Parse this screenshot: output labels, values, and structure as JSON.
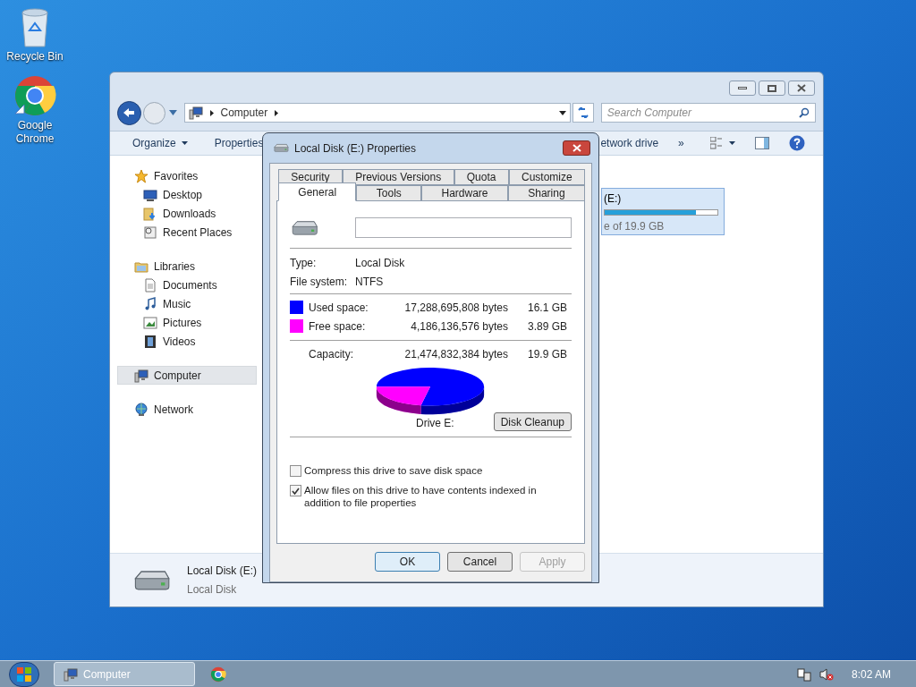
{
  "desktop_icons": [
    {
      "label": "Recycle Bin",
      "kind": "recycle-bin"
    },
    {
      "label": "Google Chrome",
      "kind": "chrome"
    }
  ],
  "explorer": {
    "address": {
      "crumbs": [
        "Computer"
      ]
    },
    "search": {
      "placeholder": "Search Computer"
    },
    "toolbar": {
      "left": [
        {
          "label": "Organize",
          "menu": true
        },
        {
          "label": "Properties",
          "menu": false
        }
      ],
      "right": [
        "etwork drive",
        "»"
      ]
    },
    "nav": [
      {
        "label": "Favorites",
        "kind": "star",
        "selected": false,
        "children": [
          {
            "label": "Desktop",
            "kind": "desktop",
            "selected": false
          },
          {
            "label": "Downloads",
            "kind": "downloads",
            "selected": false
          },
          {
            "label": "Recent Places",
            "kind": "recent",
            "selected": false
          }
        ]
      },
      {
        "label": "Libraries",
        "kind": "library",
        "selected": false,
        "children": [
          {
            "label": "Documents",
            "kind": "document",
            "selected": false
          },
          {
            "label": "Music",
            "kind": "music",
            "selected": false
          },
          {
            "label": "Pictures",
            "kind": "pictures",
            "selected": false
          },
          {
            "label": "Videos",
            "kind": "videos",
            "selected": false
          }
        ]
      },
      {
        "label": "Computer",
        "kind": "computer",
        "selected": true
      },
      {
        "label": "Network",
        "kind": "network",
        "selected": false
      }
    ],
    "drive_tile": {
      "label": "(E:)",
      "level": 0.81,
      "caption": "e of 19.9 GB",
      "selected": true
    },
    "details": {
      "name": "Local Disk (E:)",
      "type": "Local Disk"
    }
  },
  "dialog": {
    "title": "Local Disk (E:) Properties",
    "tab_rows": [
      [
        {
          "label": "Security",
          "selected": false
        },
        {
          "label": "Previous Versions",
          "selected": false
        },
        {
          "label": "Quota",
          "selected": false
        },
        {
          "label": "Customize",
          "selected": false
        }
      ],
      [
        {
          "label": "General",
          "selected": true
        },
        {
          "label": "Tools",
          "selected": false
        },
        {
          "label": "Hardware",
          "selected": false
        },
        {
          "label": "Sharing",
          "selected": false
        }
      ]
    ],
    "info": [
      {
        "label": "Type:",
        "value": "Local Disk"
      },
      {
        "label": "File system:",
        "value": "NTFS"
      }
    ],
    "space": [
      {
        "label": "Used space:",
        "bytes": "17,288,695,808 bytes",
        "size": "16.1 GB",
        "color": "#0000ff"
      },
      {
        "label": "Free space:",
        "bytes": "4,186,136,576 bytes",
        "size": "3.89 GB",
        "color": "#ff00ff"
      }
    ],
    "capacity": {
      "label": "Capacity:",
      "bytes": "21,474,832,384 bytes",
      "size": "19.9 GB"
    },
    "drive_label": "Drive E:",
    "cleanup_button": "Disk Cleanup",
    "checkboxes": [
      {
        "label": "Compress this drive to save disk space",
        "checked": false
      },
      {
        "label": "Allow files on this drive to have contents indexed in addition to file properties",
        "checked": true
      }
    ],
    "buttons": [
      {
        "label": "OK",
        "default": true,
        "disabled": false
      },
      {
        "label": "Cancel",
        "default": false,
        "disabled": false
      },
      {
        "label": "Apply",
        "default": false,
        "disabled": true
      }
    ]
  },
  "taskbar": {
    "tasks": [
      {
        "label": "Computer",
        "selected": true
      }
    ],
    "clock": "8:02 AM"
  }
}
